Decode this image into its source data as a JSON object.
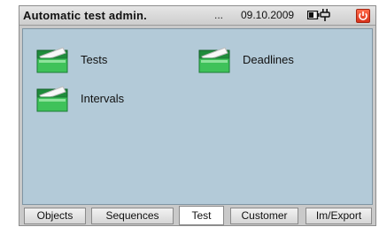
{
  "window": {
    "title": "Automatic test admin.",
    "ellipsis": "...",
    "date": "09.10.2009",
    "battery_icon": "battery-icon",
    "power_icon": "power-plug-icon",
    "close_icon": "power-off-icon"
  },
  "main": {
    "items": [
      {
        "label": "Tests",
        "icon": "folder-icon"
      },
      {
        "label": "Deadlines",
        "icon": "folder-icon"
      },
      {
        "label": "Intervals",
        "icon": "folder-icon"
      }
    ]
  },
  "tabs": [
    {
      "label": "Objects",
      "active": false
    },
    {
      "label": "Sequences",
      "active": false
    },
    {
      "label": "Test",
      "active": true
    },
    {
      "label": "Customer",
      "active": false
    },
    {
      "label": "Im/Export",
      "active": false
    }
  ],
  "colors": {
    "content_bg": "#b3cad8",
    "folder_green": "#2fae4a",
    "close_red": "#d8321b"
  }
}
